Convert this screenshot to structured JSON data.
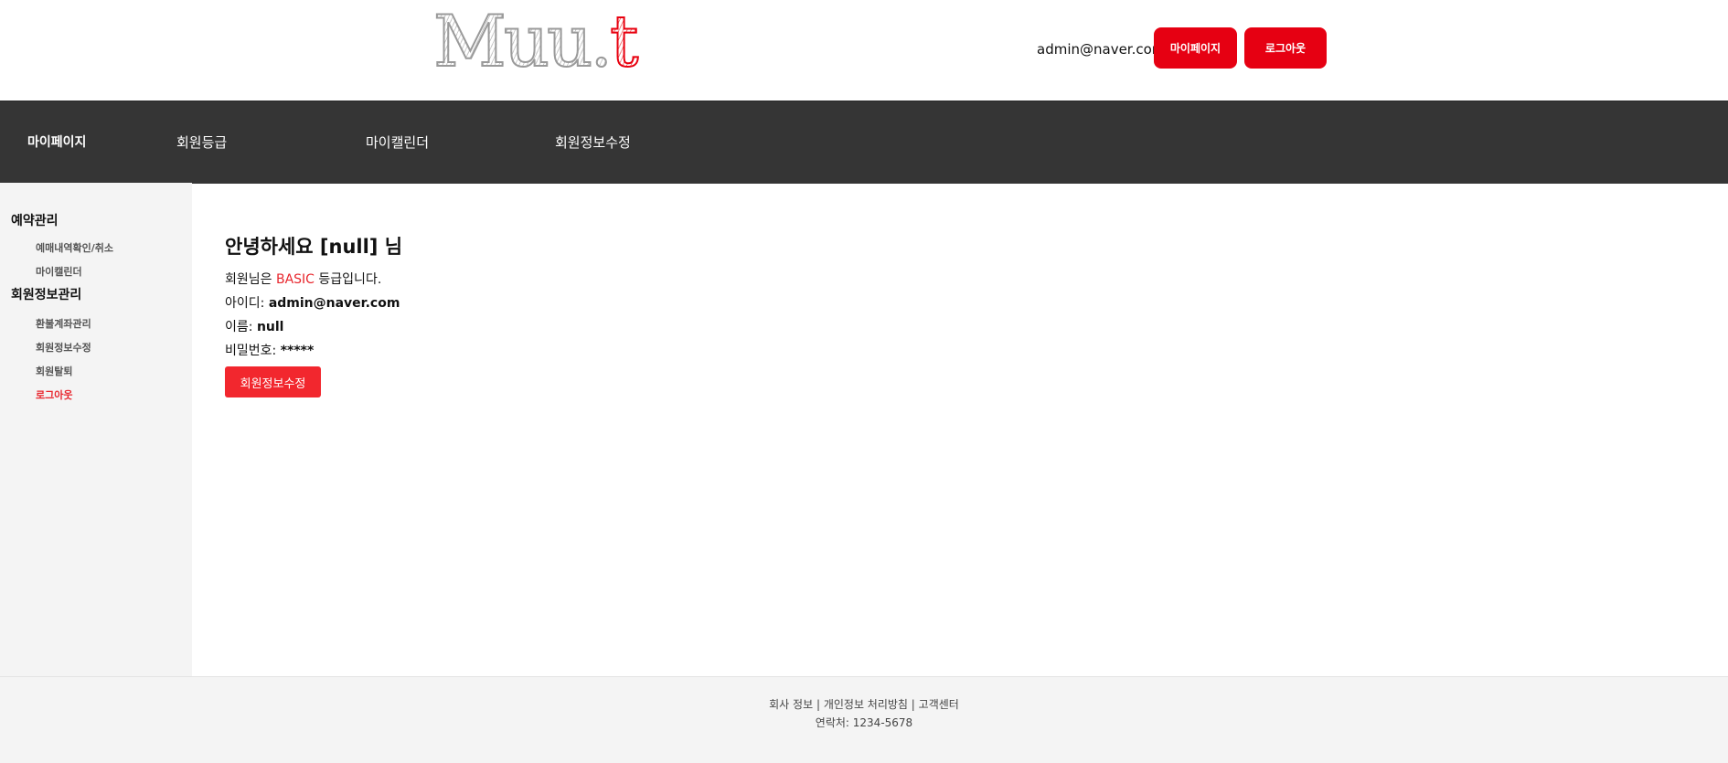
{
  "header": {
    "logo_main": "Muu.",
    "logo_accent": "t",
    "user_email": "admin@naver.com",
    "mypage_label": "마이페이지",
    "logout_label": "로그아웃"
  },
  "nav": {
    "items": [
      {
        "label": "마이페이지"
      },
      {
        "label": "회원등급"
      },
      {
        "label": "마이캘린더"
      },
      {
        "label": "회원정보수정"
      }
    ]
  },
  "sidebar": {
    "sections": [
      {
        "title": "예약관리",
        "links": [
          {
            "label": "예매내역확인/취소"
          },
          {
            "label": "마이캘린더"
          }
        ]
      },
      {
        "title": "회원정보관리",
        "links": [
          {
            "label": "환불계좌관리"
          },
          {
            "label": "회원정보수정"
          },
          {
            "label": "회원탈퇴"
          },
          {
            "label": "로그아웃"
          }
        ]
      }
    ]
  },
  "main": {
    "greeting": "안녕하세요 [null] 님",
    "grade_prefix": "회원님은",
    "grade_value": "BASIC",
    "grade_suffix": "등급입니다.",
    "id_label": "아이디:",
    "id_value": "admin@naver.com",
    "name_label": "이름:",
    "name_value": "null",
    "password_label": "비밀번호:",
    "password_value": "*****",
    "edit_button": "회원정보수정"
  },
  "footer": {
    "company_info": "회사 정보",
    "privacy": "개인정보 처리방침",
    "support": "고객센터",
    "separator": "|",
    "contact": "연락처: 1234-5678"
  },
  "colors": {
    "accent": "#e60012",
    "nav_bg": "#353535",
    "sidebar_bg": "#f4f4f4",
    "grade": "#e8262d"
  }
}
